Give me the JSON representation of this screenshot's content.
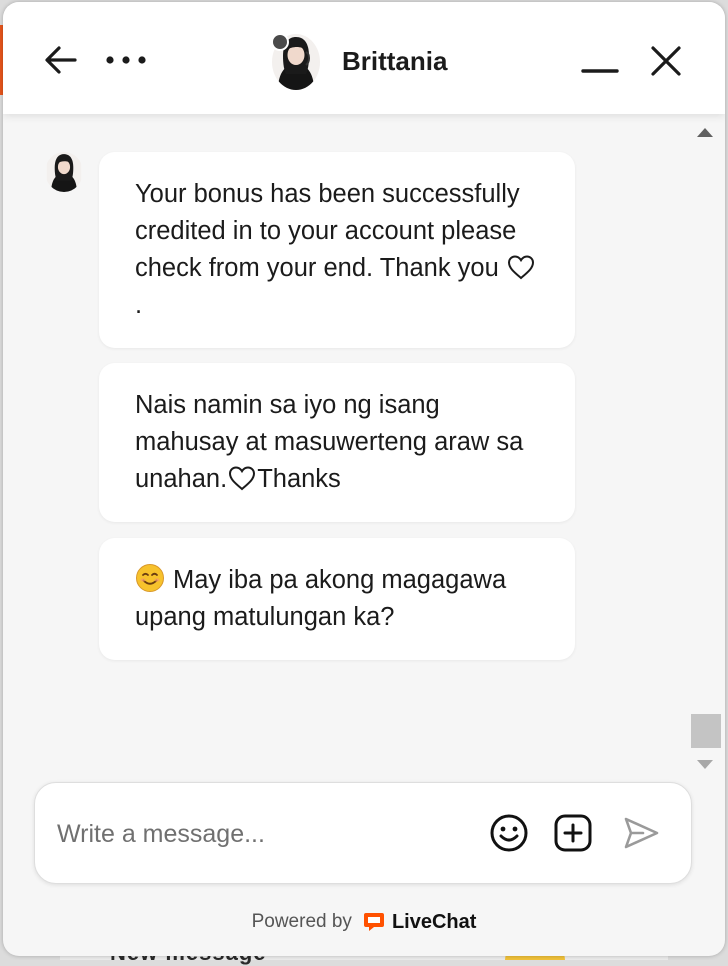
{
  "header": {
    "agent_name": "Brittania",
    "back_icon": "arrow-left-icon",
    "more_icon": "more-horizontal-icon",
    "minimize_icon": "minimize-icon",
    "close_icon": "close-icon",
    "status_color": "#4a4a4a"
  },
  "messages": [
    {
      "text": "Your bonus has been successfully credited in to your account please check from your end. Thank you",
      "trailing_icon": "heart-outline-icon",
      "trailing_text": "."
    },
    {
      "text": "Nais namin sa iyo ng isang mahusay at masuwerteng araw sa unahan.",
      "inline_icon": "heart-outline-icon",
      "trailing_text": "Thanks"
    },
    {
      "leading_icon": "smiling-face-icon",
      "text": "May iba pa akong magagawa upang matulungan ka?"
    }
  ],
  "composer": {
    "placeholder": "Write a message...",
    "emoji_icon": "emoji-icon",
    "attach_icon": "add-attachment-icon",
    "send_icon": "send-icon"
  },
  "footer": {
    "powered_by": "Powered by",
    "brand": "LiveChat",
    "brand_color": "#ff5100"
  },
  "background": {
    "partial_text": "New message",
    "accent_color": "#e8561c"
  }
}
